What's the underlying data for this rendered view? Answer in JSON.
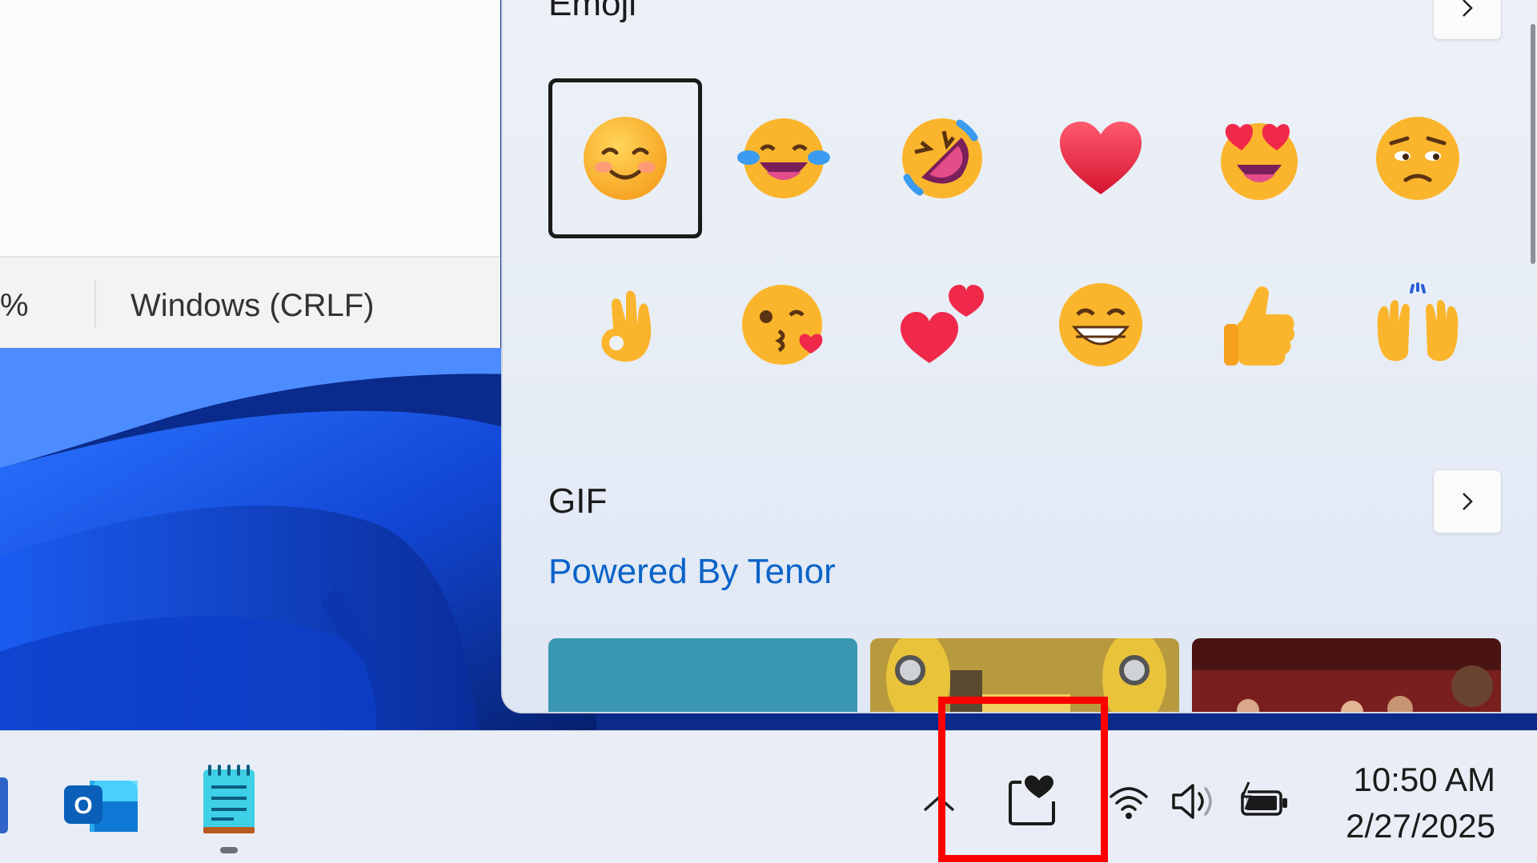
{
  "notepad": {
    "status_zoom_partial": "%",
    "status_line_ending": "Windows (CRLF)"
  },
  "emoji_panel": {
    "emoji_section_title": "Emoji",
    "emoji_more_icon": "chevron-right-icon",
    "emojis": [
      {
        "name": "smiling-face-with-smiling-eyes",
        "glyph": "😊",
        "selected": true
      },
      {
        "name": "face-with-tears-of-joy",
        "glyph": "😂",
        "selected": false
      },
      {
        "name": "rolling-on-the-floor-laughing",
        "glyph": "🤣",
        "selected": false
      },
      {
        "name": "red-heart",
        "glyph": "❤️",
        "selected": false
      },
      {
        "name": "smiling-face-with-heart-eyes",
        "glyph": "😍",
        "selected": false
      },
      {
        "name": "pensive-face",
        "glyph": "😒",
        "selected": false
      },
      {
        "name": "ok-hand",
        "glyph": "👌",
        "selected": false
      },
      {
        "name": "face-blowing-a-kiss",
        "glyph": "😘",
        "selected": false
      },
      {
        "name": "two-hearts",
        "glyph": "💕",
        "selected": false
      },
      {
        "name": "beaming-face",
        "glyph": "😁",
        "selected": false
      },
      {
        "name": "thumbs-up",
        "glyph": "👍",
        "selected": false
      },
      {
        "name": "raising-hands",
        "glyph": "🙌",
        "selected": false
      }
    ],
    "gif_section_title": "GIF",
    "gif_more_icon": "chevron-right-icon",
    "powered_by": "Powered By Tenor"
  },
  "taskbar": {
    "apps": [
      "outlook-icon",
      "notepad-icon"
    ],
    "tray": {
      "overflow_icon": "chevron-up-icon",
      "emoji_icon": "emoji-heart-clipboard-icon",
      "wifi_icon": "wifi-icon",
      "volume_icon": "volume-icon",
      "battery_icon": "battery-charging-icon"
    },
    "time": "10:50 AM",
    "date": "2/27/2025"
  },
  "colors": {
    "accent_link": "#0a63c9",
    "highlight": "#ff0000"
  }
}
